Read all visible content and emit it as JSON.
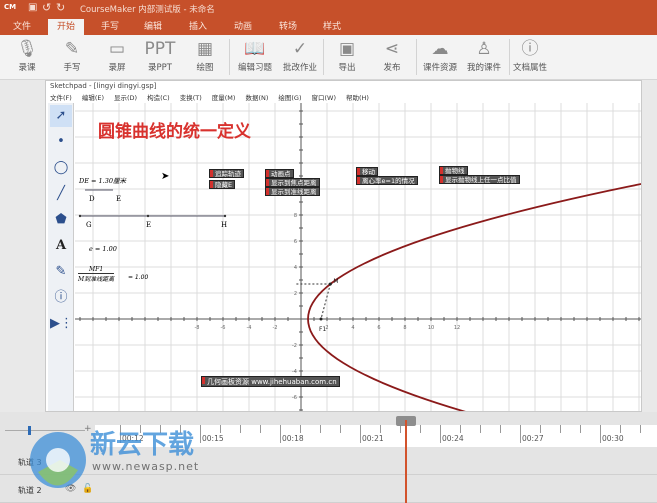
{
  "app": {
    "logo": "CM",
    "title": "CourseMaker 内部测试版 - 未命名"
  },
  "tabs": [
    {
      "label": "文件"
    },
    {
      "label": "开始",
      "active": true
    },
    {
      "label": "手写"
    },
    {
      "label": "编辑"
    },
    {
      "label": "插入"
    },
    {
      "label": "动画"
    },
    {
      "label": "转场"
    },
    {
      "label": "样式"
    }
  ],
  "ribbon": [
    {
      "label": "录课",
      "icon": "microphone-icon",
      "glyph": "🎙"
    },
    {
      "label": "手写",
      "icon": "pen-icon",
      "glyph": "✎"
    },
    {
      "label": "录屏",
      "icon": "screen-icon",
      "glyph": "▭"
    },
    {
      "label": "录PPT",
      "icon": "ppt-icon",
      "glyph": "PPT"
    },
    {
      "label": "绘图",
      "icon": "draw-icon",
      "glyph": "▦"
    },
    {
      "label": "编辑习题",
      "icon": "book-icon",
      "glyph": "📖"
    },
    {
      "label": "批改作业",
      "icon": "check-icon",
      "glyph": "✓"
    },
    {
      "label": "导出",
      "icon": "film-icon",
      "glyph": "▣"
    },
    {
      "label": "发布",
      "icon": "share-icon",
      "glyph": "⋖"
    },
    {
      "label": "课件资源",
      "icon": "cloud-icon",
      "glyph": "☁"
    },
    {
      "label": "我的课件",
      "icon": "user-icon",
      "glyph": "♙"
    },
    {
      "label": "文档属性",
      "icon": "info-icon",
      "glyph": "ⓘ"
    }
  ],
  "sketchpad": {
    "title": "Sketchpad - [lingyi dingyi.gsp]",
    "menu": [
      "文件(F)",
      "编辑(E)",
      "显示(D)",
      "构造(C)",
      "变换(T)",
      "度量(M)",
      "数据(N)",
      "绘图(G)",
      "窗口(W)",
      "帮助(H)"
    ],
    "heading": "圆锥曲线的统一定义",
    "measure_de": "DE = 1.30厘米",
    "labels": {
      "d": "D",
      "e": "E",
      "g": "G",
      "e2": "E",
      "h": "H",
      "m": "M",
      "f1": "F1"
    },
    "eccentricity": "e = 1.00",
    "ratio_num": "MF1",
    "ratio_den": "M到准线距离",
    "ratio_val": "= 1.00",
    "buttons": [
      "追踪轨迹",
      "隐藏E",
      "动画点",
      "显示到焦点距离",
      "显示到准线距离",
      "移动",
      "离心率e=1的情况",
      "抛物线",
      "显示抛物线上任一点比值"
    ],
    "link_button": "几何画板资源 www.jihehuaban.com.cn",
    "x_ticks": [
      -8,
      -6,
      -4,
      -2,
      2,
      4,
      6,
      8,
      10,
      12
    ],
    "y_ticks": [
      8,
      6,
      4,
      2,
      -2,
      -4,
      -6
    ],
    "curve_color": "#8b1a1a",
    "heading_color": "#d8322e"
  },
  "timeline": {
    "times": [
      "00:12",
      "00:15",
      "00:18",
      "00:21",
      "00:24",
      "00:27",
      "00:30"
    ],
    "tracks": [
      "轨道 3",
      "轨道 2"
    ],
    "accent": "#d2532c"
  },
  "watermark": {
    "name": "新云下载",
    "url": "www.newasp.net"
  }
}
